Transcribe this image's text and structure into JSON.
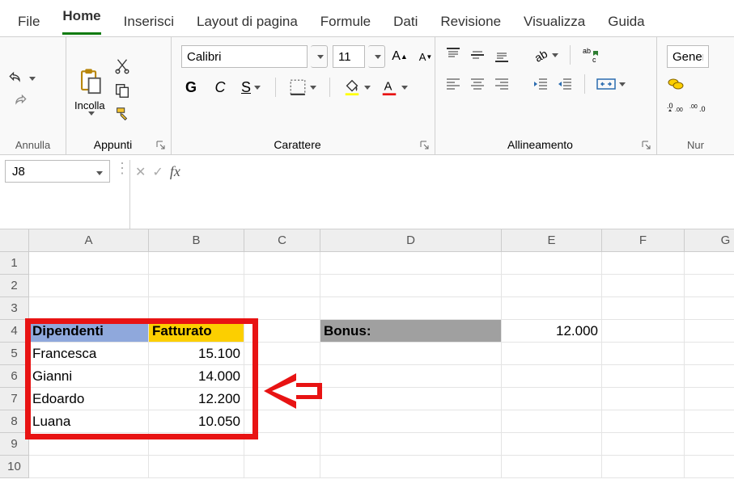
{
  "tabs": {
    "file": "File",
    "home": "Home",
    "insert": "Inserisci",
    "layout": "Layout di pagina",
    "formulas": "Formule",
    "data": "Dati",
    "review": "Revisione",
    "view": "Visualizza",
    "help": "Guida"
  },
  "groups": {
    "undo": "Annulla",
    "clipboard": "Appunti",
    "font": "Carattere",
    "align": "Allineamento",
    "num": "Nur"
  },
  "ribbon": {
    "paste": "Incolla",
    "font_name": "Calibri",
    "font_size": "11",
    "bold": "G",
    "italic": "C",
    "underline": "S",
    "numfmt": "Genera"
  },
  "namebox": "J8",
  "formula": "",
  "columns": [
    "A",
    "B",
    "C",
    "D",
    "E",
    "F",
    "G"
  ],
  "rows": [
    "1",
    "2",
    "3",
    "4",
    "5",
    "6",
    "7",
    "8",
    "9",
    "10"
  ],
  "cells": {
    "A4": "Dipendenti",
    "B4": "Fatturato",
    "D4": "Bonus:",
    "E4": "12.000",
    "A5": "Francesca",
    "B5": "15.100",
    "A6": "Gianni",
    "B6": "14.000",
    "A7": "Edoardo",
    "B7": "12.200",
    "A8": "Luana",
    "B8": "10.050"
  }
}
